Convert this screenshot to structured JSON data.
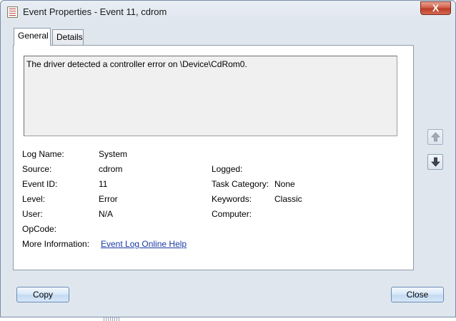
{
  "window": {
    "title": "Event Properties - Event 11, cdrom",
    "close_glyph": "X"
  },
  "tabs": [
    {
      "label": "General",
      "active": true
    },
    {
      "label": "Details",
      "active": false
    }
  ],
  "event": {
    "description": "The driver detected a controller error on \\Device\\CdRom0.",
    "log_name_label": "Log Name:",
    "log_name": "System",
    "source_label": "Source:",
    "source": "cdrom",
    "logged_label": "Logged:",
    "logged": "",
    "event_id_label": "Event ID:",
    "event_id": "11",
    "task_category_label": "Task Category:",
    "task_category": "None",
    "level_label": "Level:",
    "level": "Error",
    "keywords_label": "Keywords:",
    "keywords": "Classic",
    "user_label": "User:",
    "user": "N/A",
    "computer_label": "Computer:",
    "computer": "",
    "opcode_label": "OpCode:",
    "opcode": "",
    "more_info_label": "More Information:",
    "more_info_link": "Event Log Online Help"
  },
  "buttons": {
    "copy": "Copy",
    "close": "Close"
  },
  "icons": {
    "scroll_up": "arrow-up-icon",
    "scroll_down": "arrow-down-icon"
  },
  "colors": {
    "link": "#1a3aa5",
    "close_button": "#c8462f"
  }
}
